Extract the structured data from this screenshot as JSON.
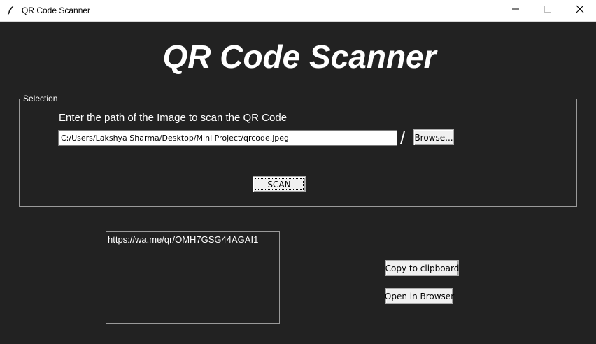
{
  "window": {
    "title": "QR Code Scanner",
    "icons": {
      "app": "feather-icon",
      "minimize": "minimize-icon",
      "maximize": "maximize-icon",
      "close": "close-icon"
    }
  },
  "app": {
    "heading": "QR Code Scanner"
  },
  "selection": {
    "legend": "Selection",
    "prompt": "Enter the path of the Image to scan the QR Code",
    "path_value": "C:/Users/Lakshya Sharma/Desktop/Mini Project/qrcode.jpeg",
    "separator": "/",
    "browse_label": "Browse...",
    "scan_label": "SCAN"
  },
  "result": {
    "text": "https://wa.me/qr/OMH7GSG44AGAI1",
    "copy_label": "Copy to clipboard",
    "open_label": "Open in Browser"
  },
  "colors": {
    "background": "#222222",
    "text": "#ffffff",
    "button_face": "#f0f0f0"
  }
}
